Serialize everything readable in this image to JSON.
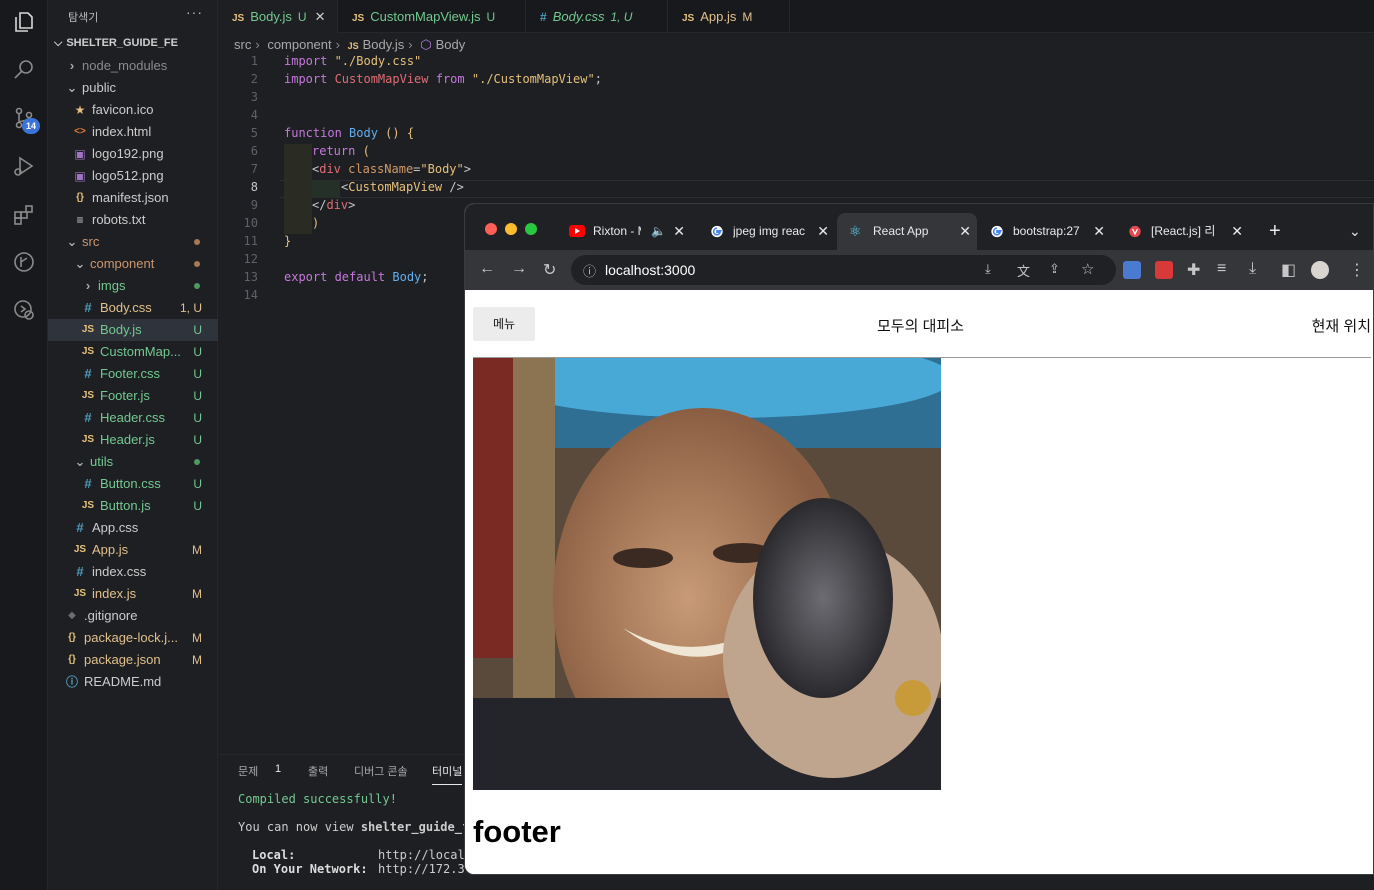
{
  "vscode": {
    "explorer": {
      "title": "탐색기",
      "more": "···",
      "project": "SHELTER_GUIDE_FE",
      "scm_badge": "14",
      "items": [
        {
          "label": "node_modules",
          "depth": 1,
          "kind": "folder-closed",
          "color": "dim"
        },
        {
          "label": "public",
          "depth": 1,
          "kind": "folder-open",
          "color": "normal"
        },
        {
          "label": "favicon.ico",
          "depth": 2,
          "kind": "star",
          "color": "normal"
        },
        {
          "label": "index.html",
          "depth": 2,
          "kind": "html",
          "color": "normal"
        },
        {
          "label": "logo192.png",
          "depth": 2,
          "kind": "image",
          "color": "normal"
        },
        {
          "label": "logo512.png",
          "depth": 2,
          "kind": "image",
          "color": "normal"
        },
        {
          "label": "manifest.json",
          "depth": 2,
          "kind": "json",
          "color": "normal"
        },
        {
          "label": "robots.txt",
          "depth": 2,
          "kind": "text",
          "color": "normal"
        },
        {
          "label": "src",
          "depth": 1,
          "kind": "folder-open",
          "color": "orange",
          "dot": "#a67a55"
        },
        {
          "label": "component",
          "depth": 2,
          "kind": "folder-open",
          "color": "orange",
          "dot": "#a67a55"
        },
        {
          "label": "imgs",
          "depth": 3,
          "kind": "folder-closed",
          "color": "green",
          "dot": "#4f9a62"
        },
        {
          "label": "Body.css",
          "depth": 3,
          "kind": "css",
          "color": "gold",
          "status": "1, U"
        },
        {
          "label": "Body.js",
          "depth": 3,
          "kind": "js",
          "color": "green",
          "status": "U",
          "selected": true
        },
        {
          "label": "CustomMap...",
          "depth": 3,
          "kind": "js",
          "color": "green",
          "status": "U"
        },
        {
          "label": "Footer.css",
          "depth": 3,
          "kind": "css",
          "color": "green",
          "status": "U"
        },
        {
          "label": "Footer.js",
          "depth": 3,
          "kind": "js",
          "color": "green",
          "status": "U"
        },
        {
          "label": "Header.css",
          "depth": 3,
          "kind": "css",
          "color": "green",
          "status": "U"
        },
        {
          "label": "Header.js",
          "depth": 3,
          "kind": "js",
          "color": "green",
          "status": "U"
        },
        {
          "label": "utils",
          "depth": 2,
          "kind": "folder-open",
          "color": "green",
          "dot": "#4f9a62"
        },
        {
          "label": "Button.css",
          "depth": 3,
          "kind": "css",
          "color": "green",
          "status": "U"
        },
        {
          "label": "Button.js",
          "depth": 3,
          "kind": "js",
          "color": "green",
          "status": "U"
        },
        {
          "label": "App.css",
          "depth": 2,
          "kind": "css",
          "color": "normal"
        },
        {
          "label": "App.js",
          "depth": 2,
          "kind": "js",
          "color": "gold",
          "status": "M"
        },
        {
          "label": "index.css",
          "depth": 2,
          "kind": "css",
          "color": "normal"
        },
        {
          "label": "index.js",
          "depth": 2,
          "kind": "js",
          "color": "gold",
          "status": "M"
        },
        {
          "label": ".gitignore",
          "depth": 1,
          "kind": "git",
          "color": "normal"
        },
        {
          "label": "package-lock.j...",
          "depth": 1,
          "kind": "json",
          "color": "gold",
          "status": "M"
        },
        {
          "label": "package.json",
          "depth": 1,
          "kind": "json",
          "color": "gold",
          "status": "M"
        },
        {
          "label": "README.md",
          "depth": 1,
          "kind": "info",
          "color": "normal"
        }
      ]
    },
    "tabs": [
      {
        "icon": "JS",
        "label": "Body.js",
        "status": "U",
        "active": true
      },
      {
        "icon": "JS",
        "label": "CustomMapView.js",
        "status": "U"
      },
      {
        "icon": "#",
        "label": "Body.css",
        "status": "1, U"
      },
      {
        "icon": "JS",
        "label": "App.js",
        "status": "M"
      }
    ],
    "breadcrumb": [
      "src",
      "component",
      "Body.js",
      "Body"
    ],
    "code_lines": [
      "1",
      "2",
      "3",
      "4",
      "5",
      "6",
      "7",
      "8",
      "9",
      "10",
      "11",
      "12",
      "13",
      "14"
    ],
    "code": {
      "l1_kw": "import",
      "l1_str": " \"./Body.css\"",
      "l2_kw": "import",
      "l2_name": " CustomMapView ",
      "l2_from": "from",
      "l2_str": " \"./CustomMapView\"",
      "l2_end": ";",
      "l5_kw": "function",
      "l5_name": " Body",
      "l5_rest": " () {",
      "l6_kw": "return",
      "l6_rest": " (",
      "l7_open": "<",
      "l7_tag": "div",
      "l7_attr": " className",
      "l7_eq": "=",
      "l7_str": "\"Body\"",
      "l7_close": ">",
      "l8_open": "<",
      "l8_tag": "CustomMapView",
      "l8_close": " />",
      "l9_open": "</",
      "l9_tag": "div",
      "l9_close": ">",
      "l10": ")",
      "l11": "}",
      "l13_kw": "export default",
      "l13_name": " Body",
      "l13_end": ";"
    },
    "panel": {
      "tabs": [
        "문제",
        "1",
        "출력",
        "디버그 콘솔",
        "터미널"
      ],
      "compiled": "Compiled successfully!",
      "view_prefix": "You can now view ",
      "view_app": "shelter_guide_f",
      "local_label": "Local:",
      "local_url": "http://local",
      "network_label": "On Your Network:",
      "network_url": "http://172.3"
    }
  },
  "browser": {
    "tabs": [
      {
        "label": "Rixton - M",
        "favicon": "youtube",
        "audio": true
      },
      {
        "label": "jpeg img reac",
        "favicon": "google"
      },
      {
        "label": "React App",
        "favicon": "react",
        "active": true
      },
      {
        "label": "bootstrap:27",
        "favicon": "google"
      },
      {
        "label": "[React.js] 리액",
        "favicon": "velog"
      }
    ],
    "new_tab": "+",
    "url": "localhost:3000",
    "page": {
      "menu_button": "메뉴",
      "site_title": "모두의 대피소",
      "location_button": "현재 위치",
      "footer": "footer"
    }
  },
  "colors": {
    "editor_bg": "#1e1f23",
    "activity_bg": "#18191c",
    "untracked": "#73c991",
    "modified": "#e2c08d",
    "chrome_frame": "#202124",
    "chrome_toolbar": "#35363a",
    "scm_badge": "#3b73d9"
  }
}
